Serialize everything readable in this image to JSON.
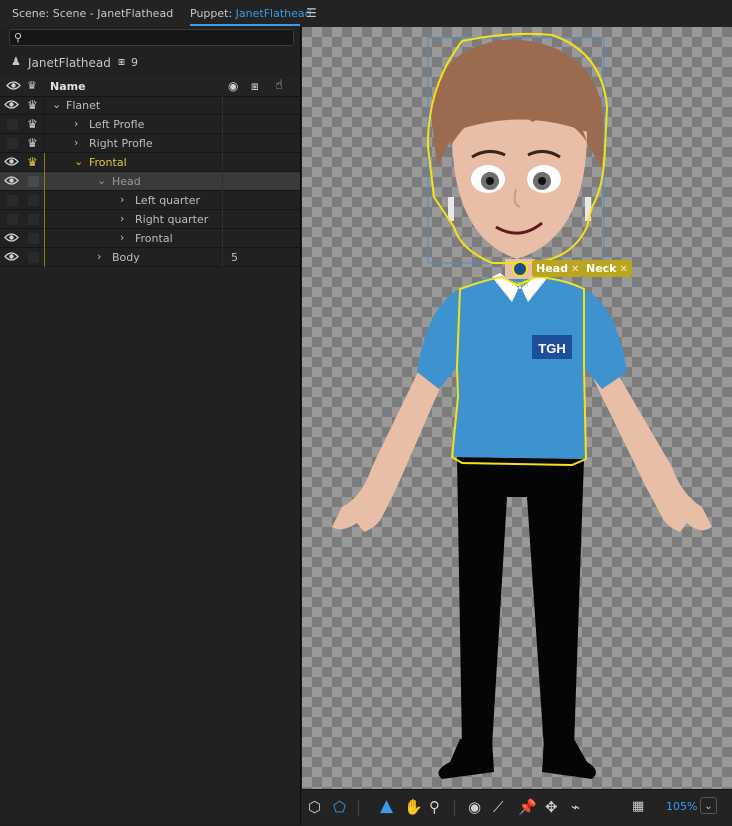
{
  "tabs": {
    "scene": "Scene: Scene - JanetFlathead",
    "puppet_prefix": "Puppet:",
    "puppet_name": "JanetFlathead",
    "menu_icon": "hamburger-icon"
  },
  "search": {
    "placeholder": "",
    "value": ""
  },
  "puppet": {
    "name": "JanetFlathead",
    "triggers_count": "9"
  },
  "columns": {
    "name": "Name"
  },
  "rows": [
    {
      "label": "Flanet",
      "badge": ""
    },
    {
      "label": "Left Profle",
      "badge": ""
    },
    {
      "label": "Right Profle",
      "badge": ""
    },
    {
      "label": "Frontal",
      "badge": ""
    },
    {
      "label": "Head",
      "badge": ""
    },
    {
      "label": "Left quarter",
      "badge": ""
    },
    {
      "label": "Right quarter",
      "badge": ""
    },
    {
      "label": "Frontal",
      "badge": ""
    },
    {
      "label": "Body",
      "badge": "5"
    }
  ],
  "stage": {
    "handle_label": "Head",
    "tags": [
      {
        "label": "Head"
      },
      {
        "label": "Neck"
      }
    ],
    "shirt_logo": "TGH"
  },
  "toolbar": {
    "zoom": "105%"
  },
  "colors": {
    "accent": "#3d9ae8",
    "selection_yellow": "#f5e11a",
    "tag_bg": "#b9a61e"
  }
}
